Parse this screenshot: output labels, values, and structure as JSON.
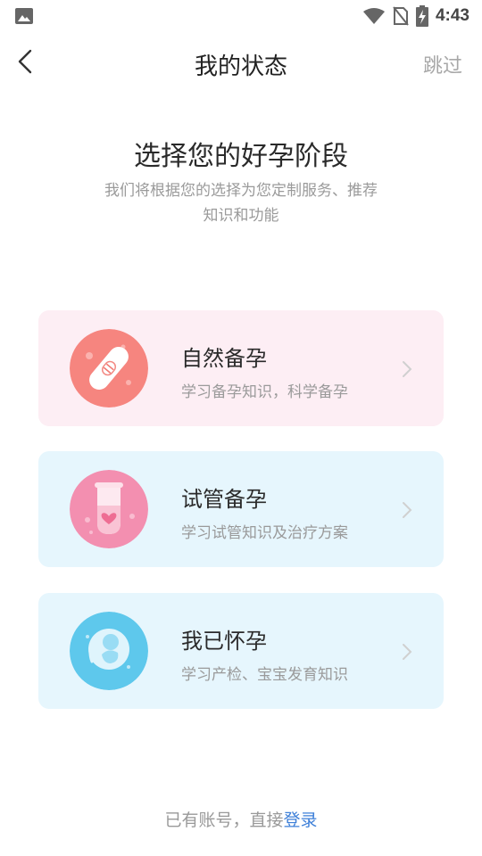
{
  "status": {
    "time": "4:43"
  },
  "nav": {
    "title": "我的状态",
    "skip_label": "跳过"
  },
  "intro": {
    "heading": "选择您的好孕阶段",
    "line1": "我们将根据您的选择为您定制服务、推荐",
    "line2": "知识和功能"
  },
  "options": [
    {
      "title": "自然备孕",
      "desc": "学习备孕知识，科学备孕",
      "icon": "test-strip-icon"
    },
    {
      "title": "试管备孕",
      "desc": "学习试管知识及治疗方案",
      "icon": "test-tube-heart-icon"
    },
    {
      "title": "我已怀孕",
      "desc": "学习产检、宝宝发育知识",
      "icon": "fetus-icon"
    }
  ],
  "footer": {
    "prefix": "已有账号，直接",
    "login_label": "登录"
  },
  "colors": {
    "accent_link": "#3d7fd8",
    "card_pink": "#fdeef4",
    "card_blue": "#e6f6fd"
  }
}
